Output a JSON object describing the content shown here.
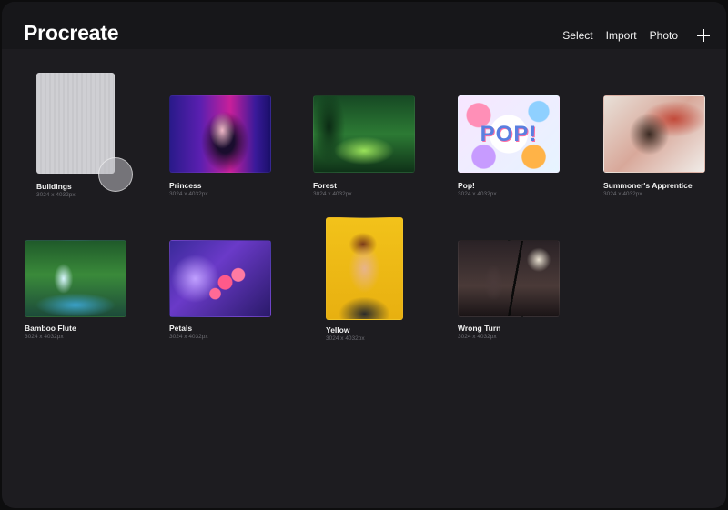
{
  "header": {
    "title": "Procreate",
    "actions": {
      "select": "Select",
      "import": "Import",
      "photo": "Photo"
    }
  },
  "gallery": [
    {
      "title": "Buildings",
      "size": "3024 x 4032px"
    },
    {
      "title": "Princess",
      "size": "3024 x 4032px"
    },
    {
      "title": "Forest",
      "size": "3024 x 4032px"
    },
    {
      "title": "Pop!",
      "size": "3024 x 4032px",
      "art_text": "POP!"
    },
    {
      "title": "Summoner's Apprentice",
      "size": "3024 x 4032px"
    },
    {
      "title": "Bamboo Flute",
      "size": "3024 x 4032px"
    },
    {
      "title": "Petals",
      "size": "3024 x 4032px"
    },
    {
      "title": "Yellow",
      "size": "3024 x 4032px"
    },
    {
      "title": "Wrong Turn",
      "size": "3024 x 4032px"
    }
  ]
}
